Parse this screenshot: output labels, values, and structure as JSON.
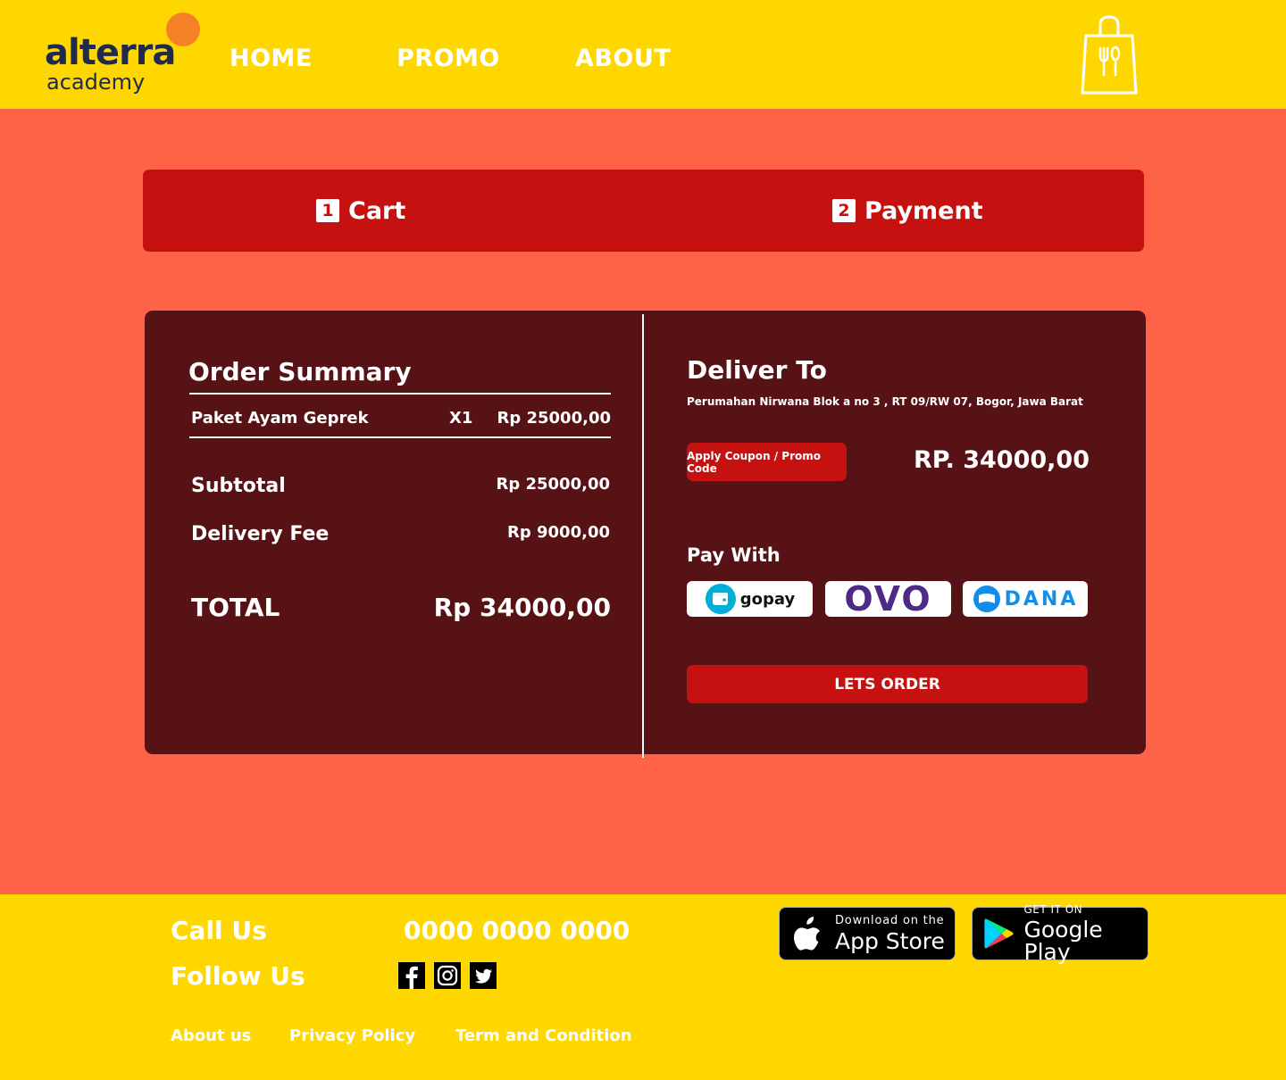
{
  "brand": {
    "name": "alterra",
    "sub": "academy"
  },
  "nav": {
    "home": "HOME",
    "promo": "PROMO",
    "about": "ABOUT"
  },
  "steps": [
    {
      "num": "1",
      "label": "Cart"
    },
    {
      "num": "2",
      "label": "Payment"
    }
  ],
  "order_summary": {
    "title": "Order Summary",
    "item": {
      "name": "Paket Ayam Geprek",
      "qty": "X1",
      "price": "Rp 25000,00"
    },
    "subtotal_label": "Subtotal",
    "subtotal_value": "Rp 25000,00",
    "delivery_label": "Delivery Fee",
    "delivery_value": "Rp 9000,00",
    "total_label": "TOTAL",
    "total_value": "Rp 34000,00"
  },
  "delivery": {
    "title": "Deliver To",
    "address": "Perumahan Nirwana Blok a no 3 , RT 09/RW 07, Bogor, Jawa Barat",
    "coupon_label": "Apply Coupon / Promo Code",
    "amount": "RP. 34000,00",
    "pay_with": "Pay With",
    "payment_options": [
      "gopay",
      "OVO",
      "DANA"
    ],
    "order_label": "LETS ORDER"
  },
  "footer": {
    "call_label": "Call Us",
    "phone": "0000 0000 0000",
    "follow_label": "Follow Us",
    "app_store": {
      "small": "Download on the",
      "big": "App Store"
    },
    "google_play": {
      "small": "GET IT ON",
      "big": "Google Play"
    },
    "links": [
      "About us",
      "Privacy Policy",
      "Term and Condition"
    ]
  },
  "colors": {
    "header_bg": "#FFD700",
    "page_bg": "#FF6347",
    "accent_red": "#C61111",
    "card_bg": "#561214"
  }
}
